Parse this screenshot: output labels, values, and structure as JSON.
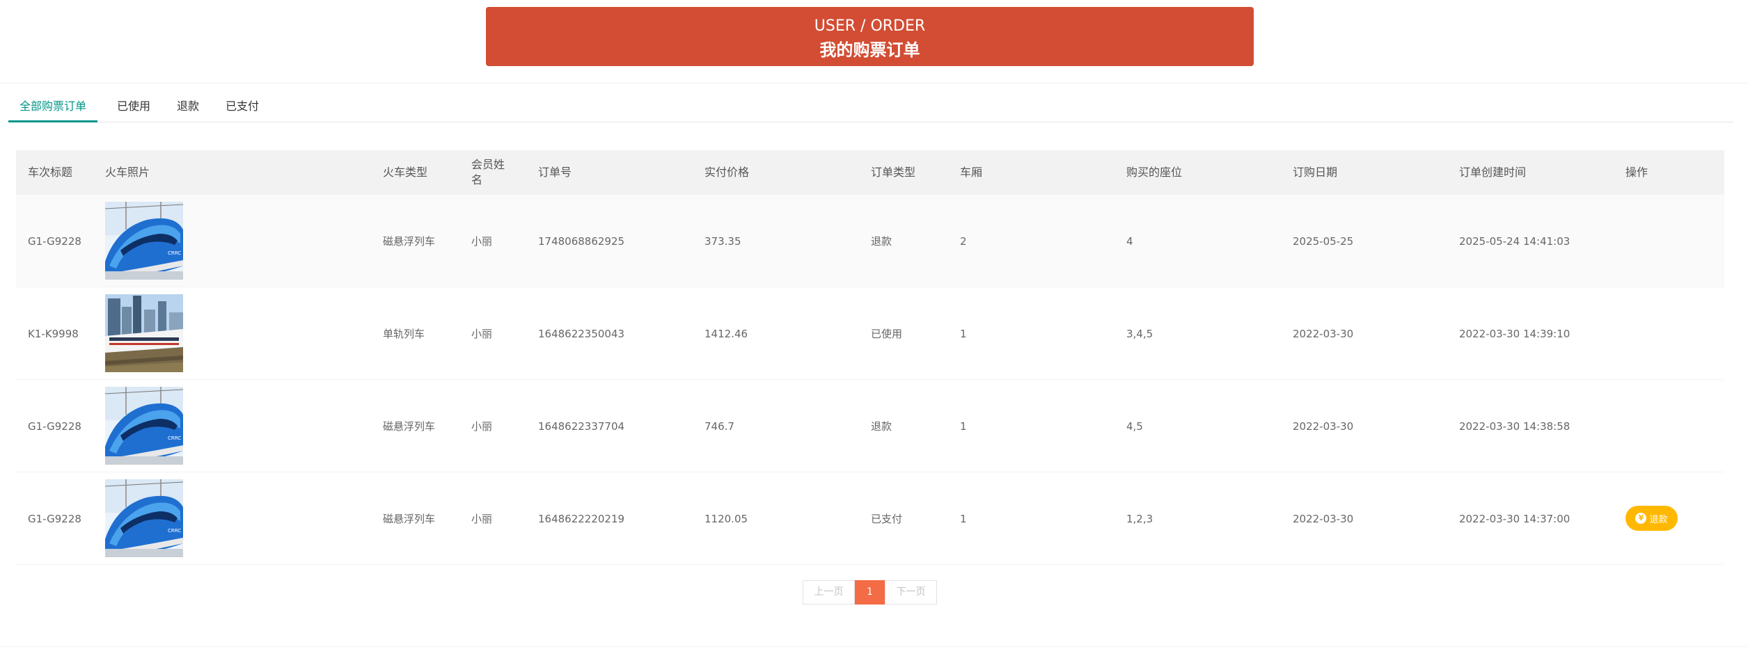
{
  "banner": {
    "en": "USER / ORDER",
    "zh": "我的购票订单"
  },
  "tabs": [
    {
      "label": "全部购票订单",
      "active": true
    },
    {
      "label": "已使用",
      "active": false
    },
    {
      "label": "退款",
      "active": false
    },
    {
      "label": "已支付",
      "active": false
    }
  ],
  "table": {
    "headers": [
      "车次标题",
      "火车照片",
      "火车类型",
      "会员姓名",
      "订单号",
      "实付价格",
      "订单类型",
      "车厢",
      "购买的座位",
      "订购日期",
      "订单创建时间",
      "操作"
    ],
    "rows": [
      {
        "title": "G1-G9228",
        "photo": "maglev-train-photo",
        "type": "磁悬浮列车",
        "member": "小丽",
        "order_no": "1748068862925",
        "price": "373.35",
        "order_type": "退款",
        "carriage": "2",
        "seats": "4",
        "date": "2025-05-25",
        "created": "2025-05-24 14:41:03",
        "action": ""
      },
      {
        "title": "K1-K9998",
        "photo": "monorail-train-photo",
        "type": "单轨列车",
        "member": "小丽",
        "order_no": "1648622350043",
        "price": "1412.46",
        "order_type": "已使用",
        "carriage": "1",
        "seats": "3,4,5",
        "date": "2022-03-30",
        "created": "2022-03-30 14:39:10",
        "action": ""
      },
      {
        "title": "G1-G9228",
        "photo": "maglev-train-photo",
        "type": "磁悬浮列车",
        "member": "小丽",
        "order_no": "1648622337704",
        "price": "746.7",
        "order_type": "退款",
        "carriage": "1",
        "seats": "4,5",
        "date": "2022-03-30",
        "created": "2022-03-30 14:38:58",
        "action": ""
      },
      {
        "title": "G1-G9228",
        "photo": "maglev-train-photo",
        "type": "磁悬浮列车",
        "member": "小丽",
        "order_no": "1648622220219",
        "price": "1120.05",
        "order_type": "已支付",
        "carriage": "1",
        "seats": "1,2,3",
        "date": "2022-03-30",
        "created": "2022-03-30 14:37:00",
        "action": "退款"
      }
    ]
  },
  "pagination": {
    "prev": "上一页",
    "current": "1",
    "next": "下一页"
  },
  "colors": {
    "banner": "#d24d33",
    "tab_active": "#009688",
    "refund_button": "#ffb800",
    "page_current": "#f36c45"
  }
}
